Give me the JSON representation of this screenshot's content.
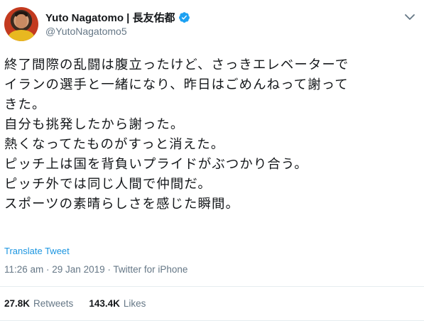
{
  "author": {
    "display_name": "Yuto Nagatomo | 長友佑都",
    "handle": "@YutoNagatomo5",
    "verified": true
  },
  "tweet": {
    "lines": [
      "終了間際の乱闘は腹立ったけど、さっきエレベーターで",
      "イランの選手と一緒になり、昨日はごめんねって謝って",
      "きた。",
      "自分も挑発したから謝った。",
      "熱くなってたものがすっと消えた。",
      "ピッチ上は国を背負いプライドがぶつかり合う。",
      "ピッチ外では同じ人間で仲間だ。",
      "スポーツの素晴らしさを感じた瞬間。"
    ],
    "translate_label": "Translate Tweet",
    "timestamp": "11:26 am · 29 Jan 2019 · Twitter for iPhone"
  },
  "stats": {
    "retweets_count": "27.8K",
    "retweets_label": "Retweets",
    "likes_count": "143.4K",
    "likes_label": "Likes"
  },
  "colors": {
    "link": "#1b95e0",
    "verified_badge": "#1da1f2",
    "muted_text": "#657786",
    "divider": "#e6ecf0"
  },
  "icons": {
    "verified": "verified-badge-icon",
    "caret": "chevron-down-icon"
  }
}
